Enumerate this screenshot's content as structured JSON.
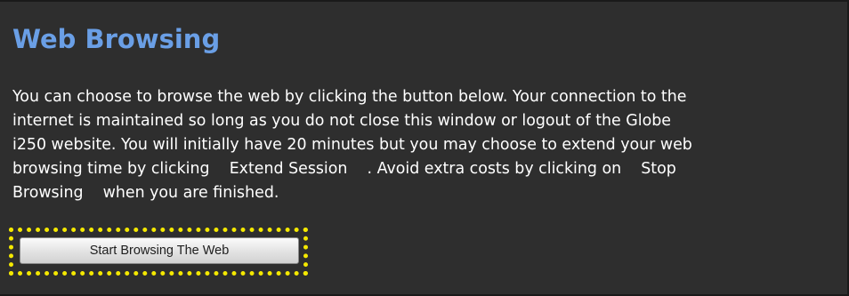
{
  "panel": {
    "title": "Web Browsing",
    "paragraph_lines": [
      "You can choose to browse the web by clicking the button below. Your connection to the",
      "internet is maintained so long as you do not close this window or logout of the Globe",
      "i250 website. You will initially have 20 minutes but you may choose to extend your web",
      "browsing time by clicking    Extend Session    . Avoid extra costs by clicking on    Stop",
      "Browsing    when you are finished."
    ],
    "start_button_label": "Start Browsing The Web"
  },
  "colors": {
    "background": "#2e2e2e",
    "title": "#6a9fe6",
    "text": "#ffffff",
    "highlight": "#f4e800"
  }
}
